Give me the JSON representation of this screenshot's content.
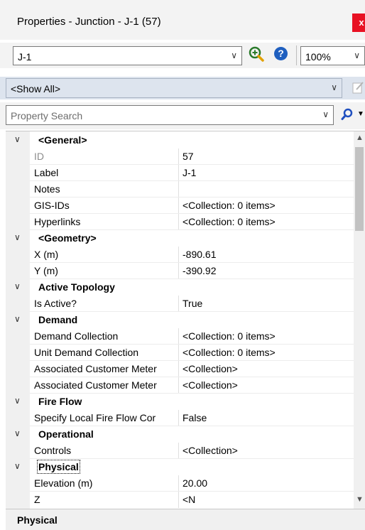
{
  "window": {
    "title": "Properties - Junction - J-1 (57)",
    "close_label": "x"
  },
  "toolbar": {
    "element_selector_value": "J-1",
    "zoom_level": "100%",
    "filter_value": "<Show All>",
    "search_placeholder": "Property Search",
    "dropdown_glyph": "∨"
  },
  "properties": {
    "general": {
      "label": "<General>",
      "rows": [
        {
          "name": "ID",
          "value": "57"
        },
        {
          "name": "Label",
          "value": "J-1"
        },
        {
          "name": "Notes",
          "value": ""
        },
        {
          "name": "GIS-IDs",
          "value": "<Collection: 0 items>"
        },
        {
          "name": "Hyperlinks",
          "value": "<Collection: 0 items>"
        }
      ]
    },
    "geometry": {
      "label": "<Geometry>",
      "rows": [
        {
          "name": "X (m)",
          "value": "-890.61"
        },
        {
          "name": "Y (m)",
          "value": "-390.92"
        }
      ]
    },
    "active_topology": {
      "label": "Active Topology",
      "rows": [
        {
          "name": "Is Active?",
          "value": "True"
        }
      ]
    },
    "demand": {
      "label": "Demand",
      "rows": [
        {
          "name": "Demand Collection",
          "value": "<Collection: 0 items>"
        },
        {
          "name": "Unit Demand Collection",
          "value": "<Collection: 0 items>"
        },
        {
          "name": "Associated Customer Meter",
          "value": "<Collection>"
        },
        {
          "name": "Associated Customer Meter",
          "value": "<Collection>"
        }
      ]
    },
    "fire_flow": {
      "label": "Fire Flow",
      "rows": [
        {
          "name": "Specify Local Fire Flow Cor",
          "value": "False"
        }
      ]
    },
    "operational": {
      "label": "Operational",
      "rows": [
        {
          "name": "Controls",
          "value": "<Collection>"
        }
      ]
    },
    "physical": {
      "label": "Physical",
      "rows": [
        {
          "name": "Elevation (m)",
          "value": "20.00"
        },
        {
          "name": "Z",
          "value": "<N"
        }
      ]
    }
  },
  "footer": {
    "selected_category": "Physical"
  },
  "colors": {
    "close": "#e81123",
    "filter_bar": "#dde4ee",
    "help": "#1f5fbf",
    "search": "#1f4fbf"
  },
  "icons": [
    "close-icon",
    "zoom-icon",
    "help-icon",
    "edit-icon",
    "search-icon",
    "chevron-down-icon"
  ]
}
